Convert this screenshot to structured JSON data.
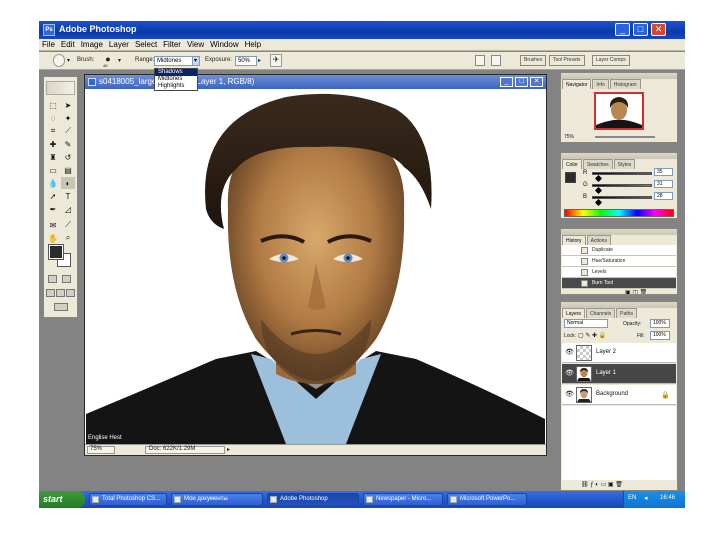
{
  "window": {
    "title": "Adobe Photoshop",
    "controls": [
      "_",
      "□",
      "✕"
    ]
  },
  "menu": [
    "File",
    "Edit",
    "Image",
    "Layer",
    "Select",
    "Filter",
    "View",
    "Window",
    "Help"
  ],
  "options_bar": {
    "brush_label": "Brush:",
    "brush_size": "48",
    "range_label": "Range:",
    "range_value": "Midtones",
    "exposure_label": "Exposure:",
    "exposure_value": "50%",
    "tabs": [
      "Brushes",
      "Tool Presets",
      "Layer Comps"
    ],
    "range_options": [
      "Shadows",
      "Midtones",
      "Highlights"
    ],
    "range_selected": "Shadows"
  },
  "document": {
    "title": "s0418005_large... @ 75% (Layer 1, RGB/8)",
    "zoom": "75%",
    "doc_size": "Doc: 622K/1.29M",
    "status_left": "Englise Hest",
    "controls": [
      "_",
      "□",
      "✕"
    ]
  },
  "panels": {
    "navigator": {
      "tabs": [
        "Navigator",
        "Info",
        "Histogram"
      ],
      "zoom": "75%"
    },
    "color": {
      "tabs": [
        "Color",
        "Swatches",
        "Styles"
      ],
      "channels": [
        {
          "label": "R",
          "value": "35",
          "color": "#c0392b"
        },
        {
          "label": "G",
          "value": "31",
          "color": "#27ae60"
        },
        {
          "label": "B",
          "value": "28",
          "color": "#2c5fcc"
        }
      ],
      "foreground": "#2b2b2b"
    },
    "history": {
      "tabs": [
        "History",
        "Actions"
      ],
      "items": [
        "Duplicate",
        "Hue/Saturation",
        "Levels",
        "Burn Tool"
      ],
      "active_index": 3
    },
    "layers": {
      "tabs": [
        "Layers",
        "Channels",
        "Paths"
      ],
      "blend_mode": "Normal",
      "opacity_label": "Opacity:",
      "opacity": "100%",
      "lock_label": "Lock:",
      "fill_label": "Fill:",
      "fill": "100%",
      "items": [
        {
          "name": "Layer 2",
          "active": false
        },
        {
          "name": "Layer 1",
          "active": true
        },
        {
          "name": "Background",
          "active": false
        }
      ]
    }
  },
  "taskbar": {
    "start_label": "start",
    "tasks": [
      "Total Photoshop CS...",
      "Мои документы",
      "Adobe Photoshop",
      "Newspaper - Micro...",
      "Microsoft PowerPo..."
    ],
    "active_task": 2,
    "clock": "16:46",
    "lang": "EN"
  },
  "colors": {
    "xp_blue": "#0a3aa8",
    "panel_bg": "#ece9d8",
    "workspace": "#838383",
    "active_layer": "#474747"
  }
}
